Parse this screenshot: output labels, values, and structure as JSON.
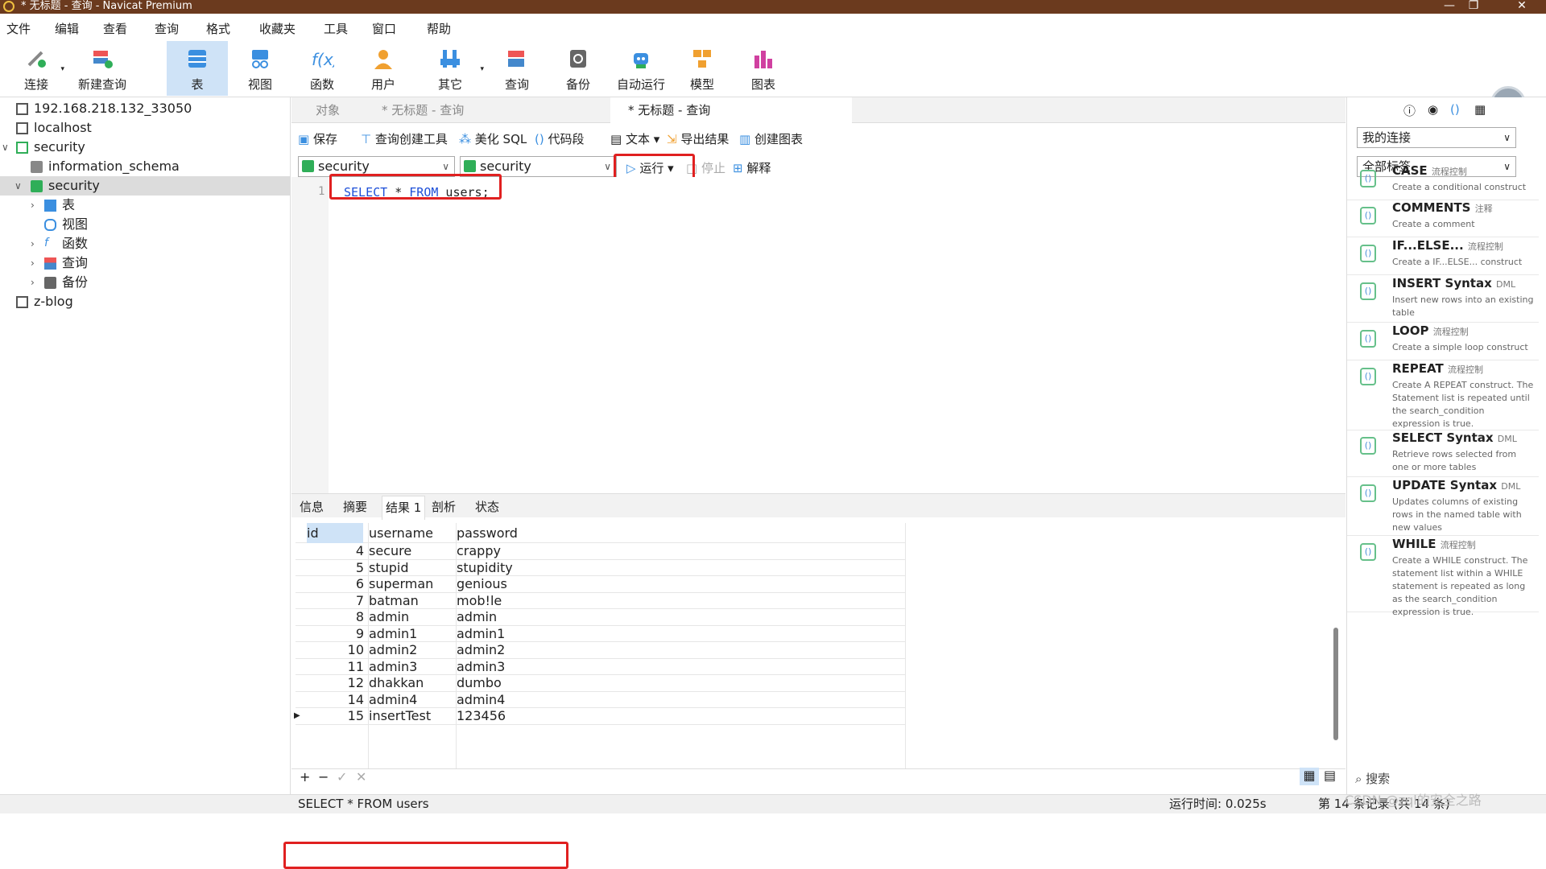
{
  "window": {
    "title": "* 无标题 - 查询 - Navicat Premium"
  },
  "menu": [
    "文件",
    "编辑",
    "查看",
    "查询",
    "格式",
    "收藏夹",
    "工具",
    "窗口",
    "帮助"
  ],
  "toolbar": [
    {
      "label": "连接"
    },
    {
      "label": "新建查询"
    },
    {
      "label": "表"
    },
    {
      "label": "视图"
    },
    {
      "label": "函数"
    },
    {
      "label": "用户"
    },
    {
      "label": "其它"
    },
    {
      "label": "查询"
    },
    {
      "label": "备份"
    },
    {
      "label": "自动运行"
    },
    {
      "label": "模型"
    },
    {
      "label": "图表"
    }
  ],
  "tree": {
    "conn1": "192.168.218.132_33050",
    "conn2": "localhost",
    "conn3": "security",
    "db1": "information_schema",
    "db2": "security",
    "items": [
      "表",
      "视图",
      "函数",
      "查询",
      "备份"
    ],
    "conn4": "z-blog"
  },
  "tabs": {
    "t0": "对象",
    "t1": "* 无标题 - 查询",
    "t2": "* 无标题 - 查询"
  },
  "qtoolbar": {
    "save": "保存",
    "builder": "查询创建工具",
    "beautify": "美化 SQL",
    "snippet": "代码段",
    "text": "文本",
    "export": "导出结果",
    "chart": "创建图表"
  },
  "selectors": {
    "conn": "security",
    "db": "security",
    "run": "运行",
    "stop": "停止",
    "explain": "解释"
  },
  "editor": {
    "line": "1",
    "kw1": "SELECT",
    "mid": " * ",
    "kw2": "FROM",
    "rest": " users;"
  },
  "result_tabs": [
    "信息",
    "摘要",
    "结果 1",
    "剖析",
    "状态"
  ],
  "grid": {
    "headers": [
      "id",
      "username",
      "password"
    ],
    "rows": [
      [
        "4",
        "secure",
        "crappy"
      ],
      [
        "5",
        "stupid",
        "stupidity"
      ],
      [
        "6",
        "superman",
        "genious"
      ],
      [
        "7",
        "batman",
        "mob!le"
      ],
      [
        "8",
        "admin",
        "admin"
      ],
      [
        "9",
        "admin1",
        "admin1"
      ],
      [
        "10",
        "admin2",
        "admin2"
      ],
      [
        "11",
        "admin3",
        "admin3"
      ],
      [
        "12",
        "dhakkan",
        "dumbo"
      ],
      [
        "14",
        "admin4",
        "admin4"
      ],
      [
        "15",
        "insertTest",
        "123456"
      ]
    ]
  },
  "status": {
    "sql": "SELECT * FROM users",
    "time": "运行时间: 0.025s",
    "records": "第 14 条记录 (共 14 条)",
    "watermark": "CSDN @zql的安全之路"
  },
  "right": {
    "conn_select": "我的连接",
    "tag_select": "全部标签",
    "search": "搜索",
    "snippets": [
      {
        "name": "CASE",
        "tag": "流程控制",
        "desc": "Create a conditional construct"
      },
      {
        "name": "COMMENTS",
        "tag": "注释",
        "desc": "Create a comment"
      },
      {
        "name": "IF...ELSE...",
        "tag": "流程控制",
        "desc": "Create a IF...ELSE... construct"
      },
      {
        "name": "INSERT Syntax",
        "tag": "DML",
        "desc": "Insert new rows into an existing table"
      },
      {
        "name": "LOOP",
        "tag": "流程控制",
        "desc": "Create a simple loop construct"
      },
      {
        "name": "REPEAT",
        "tag": "流程控制",
        "desc": "Create A REPEAT construct. The Statement list is repeated until the search_condition expression is true."
      },
      {
        "name": "SELECT Syntax",
        "tag": "DML",
        "desc": "Retrieve rows selected from one or more tables"
      },
      {
        "name": "UPDATE Syntax",
        "tag": "DML",
        "desc": "Updates columns of existing rows in the named table with new values"
      },
      {
        "name": "WHILE",
        "tag": "流程控制",
        "desc": "Create a WHILE construct. The statement list within a WHILE statement is repeated as long as the search_condition expression is true."
      }
    ]
  }
}
